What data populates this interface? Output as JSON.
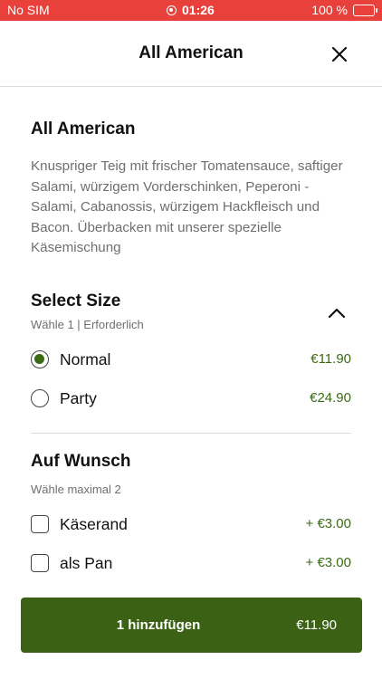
{
  "status_bar": {
    "carrier": "No SIM",
    "time": "01:26",
    "battery": "100 %"
  },
  "header": {
    "title": "All American"
  },
  "item": {
    "title": "All American",
    "description": "Knuspriger Teig mit frischer Tomatensauce, saftiger Salami, würzigem Vorderschinken, Peperoni - Salami, Cabanossis, würzigem Hackfleisch und Bacon. Überbacken mit unserer spezielle Käsemischung"
  },
  "size_section": {
    "title": "Select Size",
    "subtitle": "Wähle 1  |  Erforderlich",
    "options": [
      {
        "label": "Normal",
        "price": "€11.90",
        "selected": true
      },
      {
        "label": "Party",
        "price": "€24.90",
        "selected": false
      }
    ]
  },
  "extras_section": {
    "title": "Auf Wunsch",
    "subtitle": "Wähle maximal 2",
    "options": [
      {
        "label": "Käserand",
        "price": "+ €3.00",
        "checked": false
      },
      {
        "label": "als Pan",
        "price": "+ €3.00",
        "checked": false
      }
    ]
  },
  "cta": {
    "label": "1 hinzufügen",
    "price": "€11.90"
  },
  "colors": {
    "status_bar": "#e8413c",
    "accent": "#3a6114",
    "price_green": "#3a6b14"
  }
}
